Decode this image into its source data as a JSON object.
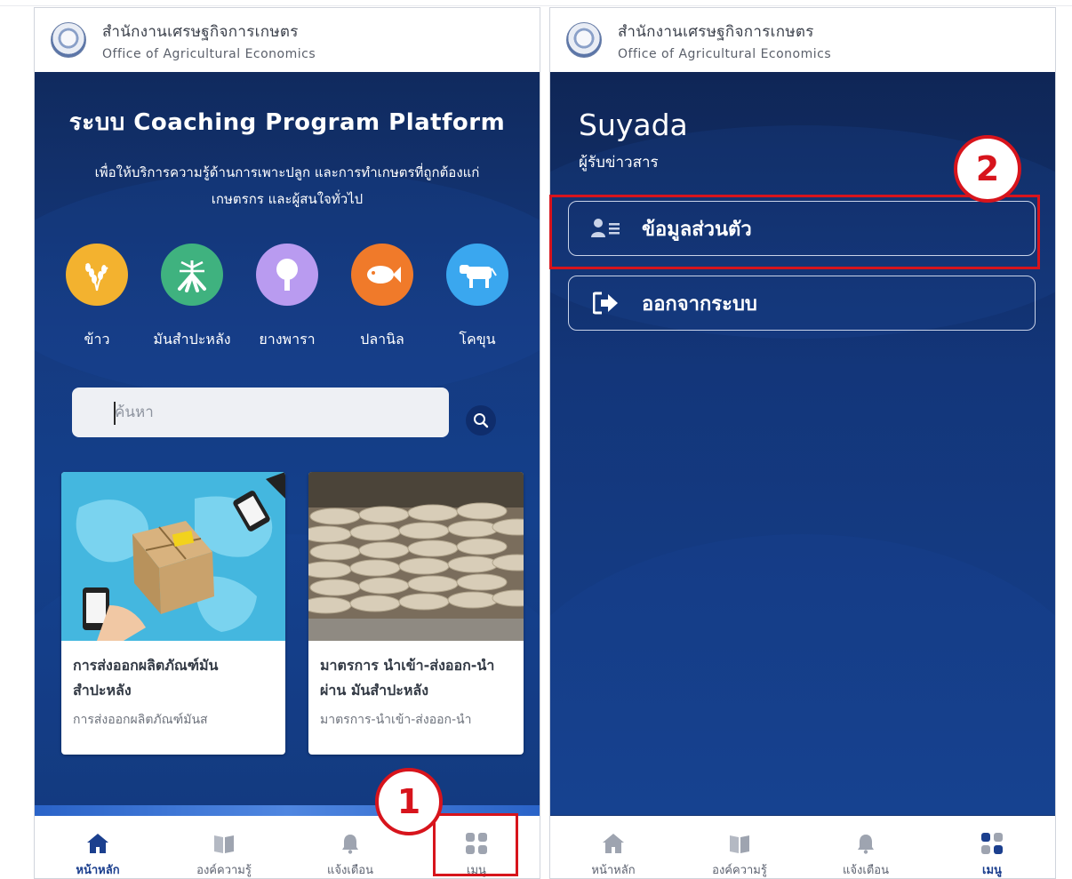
{
  "header": {
    "org_th": "สำนักงานเศรษฐกิจการเกษตร",
    "org_en": "Office of Agricultural Economics"
  },
  "home": {
    "title": "ระบบ Coaching Program Platform",
    "subtitle_line1": "เพื่อให้บริการความรู้ด้านการเพาะปลูก และการทำเกษตรที่ถูกต้องแก่",
    "subtitle_line2": "เกษตรกร และผู้สนใจทั่วไป",
    "categories": [
      {
        "label": "ข้าว",
        "icon": "rice-icon",
        "color": "#f3b22f"
      },
      {
        "label": "มันสำปะหลัง",
        "icon": "cassava-icon",
        "color": "#3fb27f"
      },
      {
        "label": "ยางพารา",
        "icon": "rubber-tree-icon",
        "color": "#b99bf0"
      },
      {
        "label": "ปลานิล",
        "icon": "fish-icon",
        "color": "#f07a2a"
      },
      {
        "label": "โคขุน",
        "icon": "cow-icon",
        "color": "#3aa7ef"
      }
    ],
    "search_placeholder": "ค้นหา",
    "cards": [
      {
        "title": "การส่งออกผลิตภัณฑ์มัน สำปะหลัง",
        "subtitle": "การส่งออกผลิตภัณฑ์มันส",
        "image": "export-parcel-image"
      },
      {
        "title": "มาตรการ นำเข้า-ส่งออก-นำผ่าน มันสำปะหลัง",
        "subtitle": "มาตรการ-นำเข้า-ส่งออก-นำ",
        "image": "sacks-warehouse-image"
      }
    ]
  },
  "profile": {
    "name": "Suyada",
    "role": "ผู้รับข่าวสาร",
    "menu": [
      {
        "label": "ข้อมูลส่วนตัว",
        "icon": "profile-list-icon"
      },
      {
        "label": "ออกจากระบบ",
        "icon": "logout-icon"
      }
    ]
  },
  "tabs_left": [
    {
      "label": "หน้าหลัก",
      "icon": "home-icon",
      "active": true
    },
    {
      "label": "องค์ความรู้",
      "icon": "book-icon",
      "active": false
    },
    {
      "label": "แจ้งเตือน",
      "icon": "bell-icon",
      "active": false
    },
    {
      "label": "เมนู",
      "icon": "menu-grid-icon",
      "active": false
    }
  ],
  "tabs_right": [
    {
      "label": "หน้าหลัก",
      "icon": "home-icon",
      "active": false
    },
    {
      "label": "องค์ความรู้",
      "icon": "book-icon",
      "active": false
    },
    {
      "label": "แจ้งเตือน",
      "icon": "bell-icon",
      "active": false
    },
    {
      "label": "เมนู",
      "icon": "menu-grid-icon",
      "active": true
    }
  ],
  "annotations": {
    "step1": "1",
    "step2": "2",
    "color": "#d7141c"
  },
  "colors": {
    "navy": "#13306a",
    "active_tab": "#1b3f8e"
  }
}
